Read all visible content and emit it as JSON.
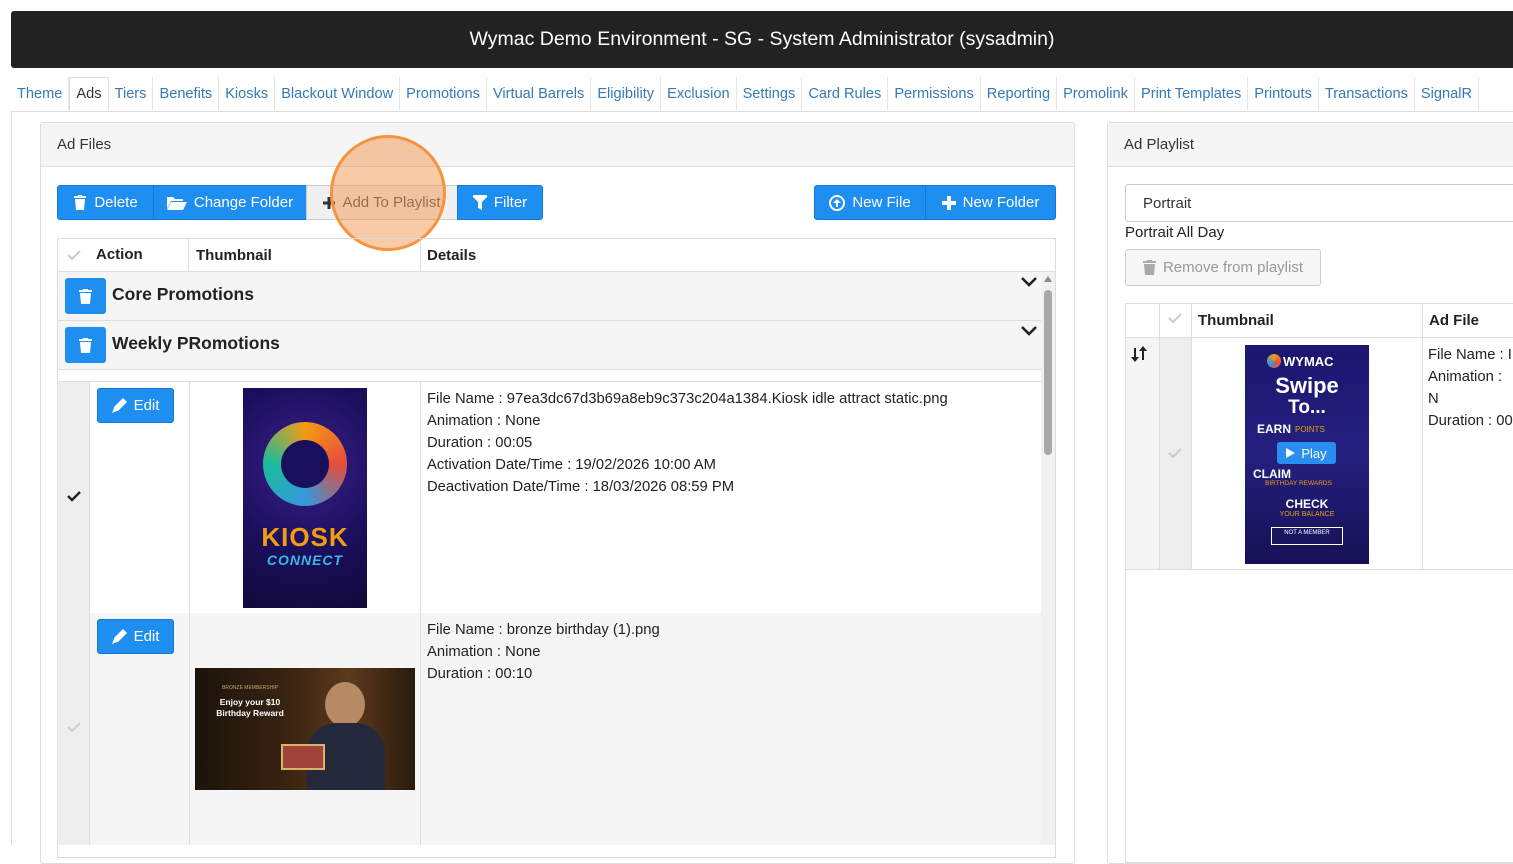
{
  "header": {
    "title": "Wymac Demo Environment - SG - System Administrator (sysadmin)"
  },
  "tabs": [
    "Theme",
    "Ads",
    "Tiers",
    "Benefits",
    "Kiosks",
    "Blackout Window",
    "Promotions",
    "Virtual Barrels",
    "Eligibility",
    "Exclusion",
    "Settings",
    "Card Rules",
    "Permissions",
    "Reporting",
    "Promolink",
    "Print Templates",
    "Printouts",
    "Transactions",
    "SignalR"
  ],
  "active_tab": "Ads",
  "ad_files": {
    "panel_title": "Ad Files",
    "toolbar": {
      "delete": "Delete",
      "change_folder": "Change Folder",
      "add_to_playlist": "Add To Playlist",
      "filter": "Filter",
      "new_file": "New File",
      "new_folder": "New Folder"
    },
    "columns": {
      "action": "Action",
      "thumbnail": "Thumbnail",
      "details": "Details"
    },
    "groups": [
      "Core Promotions",
      "Weekly PRomotions"
    ],
    "edit_label": "Edit",
    "rows": [
      {
        "file_name": "File Name : 97ea3dc67d3b69a8eb9c373c204a1384.Kiosk idle attract static.png",
        "animation": "Animation : None",
        "duration": "Duration : 00:05",
        "activation": "Activation Date/Time : 19/02/2026 10:00 AM",
        "deactivation": "Deactivation Date/Time : 18/03/2026 08:59 PM",
        "thumb": {
          "line1": "KIOSK",
          "line2": "CONNECT"
        }
      },
      {
        "file_name": "File Name : bronze birthday (1).png",
        "animation": "Animation : None",
        "duration": "Duration : 00:10",
        "thumb": {
          "line1": "BRONZE MEMBERSHIP",
          "line2": "Enjoy your $10",
          "line3": "Birthday Reward"
        }
      }
    ]
  },
  "ad_playlist": {
    "panel_title": "Ad Playlist",
    "select_value": "Portrait",
    "schedule": "Portrait All Day",
    "remove_label": "Remove from playlist",
    "columns": {
      "thumbnail": "Thumbnail",
      "ad_file": "Ad File"
    },
    "row": {
      "file_name": "File Name : I",
      "animation": "Animation : N",
      "duration": "Duration : 00",
      "thumb": {
        "brand": "WYMAC",
        "l1": "Swipe",
        "l2": "To...",
        "earn": "EARN",
        "points": "POINTS",
        "claim": "CLAIM",
        "birthday": "BIRTHDAY REWARDS",
        "check": "CHECK",
        "balance": "YOUR BALANCE",
        "member": "NOT A MEMBER",
        "play": "Play"
      }
    }
  },
  "colors": {
    "primary": "#1f8ef1",
    "header_bg": "#222222",
    "link": "#337ab7",
    "highlight": "#f5a050"
  }
}
